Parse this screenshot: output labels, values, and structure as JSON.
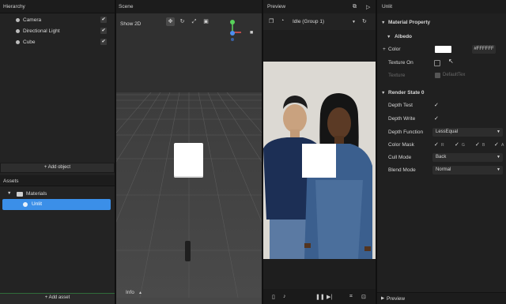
{
  "hierarchy": {
    "title": "Hierarchy",
    "items": [
      {
        "label": "Camera",
        "check": "✔"
      },
      {
        "label": "Directional Light",
        "check": "✔"
      },
      {
        "label": "Cube",
        "check": "✔"
      }
    ],
    "add_object": "+ Add object"
  },
  "assets": {
    "title": "Assets",
    "folder": "Materials",
    "selected": "Unlit",
    "add_asset": "+ Add asset"
  },
  "scene": {
    "title": "Scene",
    "toggle_2d": "Show 2D",
    "info": "Info"
  },
  "preview": {
    "title": "Preview",
    "animation": "Idle (Group 1)"
  },
  "inspector": {
    "title": "Unlit",
    "material_property": "Material Property",
    "albedo": "Albedo",
    "color_label": "Color",
    "color_value": "#FFFFFF",
    "texture_on_label": "Texture On",
    "texture_label": "Texture",
    "texture_value": "DefaultTex",
    "render_state": "Render State 0",
    "depth_test": "Depth Test",
    "depth_write": "Depth Write",
    "depth_function": "Depth Function",
    "depth_function_value": "LessEqual",
    "color_mask": "Color Mask",
    "color_mask_channels": [
      "R",
      "G",
      "B",
      "A"
    ],
    "cull_mode": "Cull Mode",
    "cull_mode_value": "Back",
    "blend_mode": "Blend Mode",
    "blend_mode_value": "Normal",
    "preview_footer": "Preview"
  },
  "colors": {
    "selection": "#3b8fe8",
    "gizmo_y": "#58d35a",
    "gizmo_z": "#4d8ef0",
    "gizmo_x": "#e85454"
  }
}
